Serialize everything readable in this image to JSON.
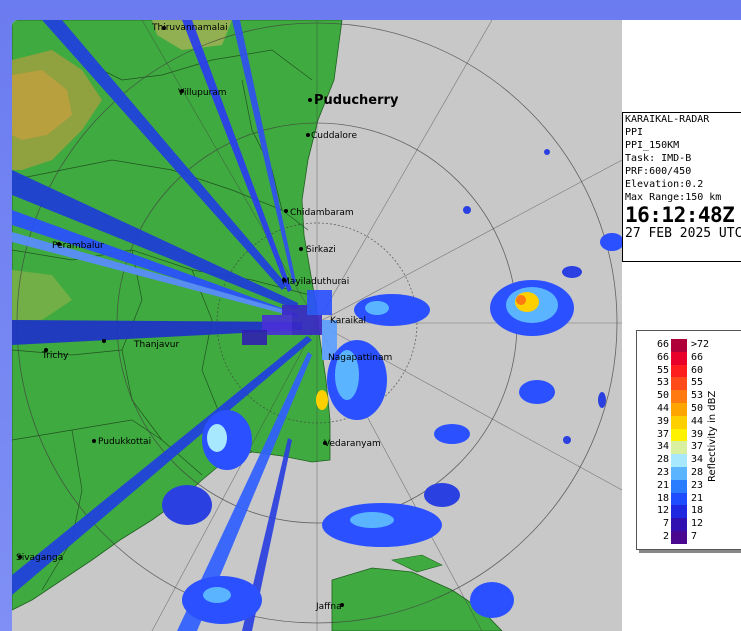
{
  "info": {
    "station": "KARAIKAL-RADAR",
    "product": "PPI",
    "range_product": "PPI_150KM",
    "task": "Task: IMD-B",
    "prf": "PRF:600/450",
    "elevation": "Elevation:0.2",
    "max_range": "Max Range:150 km",
    "time": "16:12:48Z",
    "date": "27 FEB 2025 UTC"
  },
  "legend": {
    "title": "Reflectivity in dBZ",
    "rows": [
      {
        "left": "66",
        "right": ">72",
        "color": "#b0003a"
      },
      {
        "left": "66",
        "right": "66",
        "color": "#e8002a"
      },
      {
        "left": "55",
        "right": "60",
        "color": "#ff1e1e"
      },
      {
        "left": "53",
        "right": "55",
        "color": "#ff4a1a"
      },
      {
        "left": "50",
        "right": "53",
        "color": "#ff7a10"
      },
      {
        "left": "44",
        "right": "50",
        "color": "#ffa500"
      },
      {
        "left": "39",
        "right": "44",
        "color": "#ffd000"
      },
      {
        "left": "37",
        "right": "39",
        "color": "#fff200"
      },
      {
        "left": "34",
        "right": "37",
        "color": "#d8f0a0"
      },
      {
        "left": "28",
        "right": "34",
        "color": "#a8e8ff"
      },
      {
        "left": "23",
        "right": "28",
        "color": "#5ab4ff"
      },
      {
        "left": "21",
        "right": "23",
        "color": "#2a7dff"
      },
      {
        "left": "18",
        "right": "21",
        "color": "#1e4dff"
      },
      {
        "left": "12",
        "right": "18",
        "color": "#1e28e0"
      },
      {
        "left": "7",
        "right": "12",
        "color": "#3010b0"
      },
      {
        "left": "2",
        "right": "7",
        "color": "#4a0890"
      }
    ]
  },
  "places": {
    "thiruvannamalai": "Thiruvannamalai",
    "villupuram": "Villupuram",
    "puducherry": "Puducherry",
    "cuddalore": "Cuddalore",
    "chidambaram": "Chidambaram",
    "sirkazhi": "Sirkazi",
    "mayiladuthurai": "Mayiladuthurai",
    "perambalur": "Perambalur",
    "karaikal": "Karaikal",
    "nagapattinam": "Nagapattinam",
    "trichy": "Trichy",
    "thanjavur": "Thanjavur",
    "pudukkottai": "Pudukkottai",
    "vedaranyam": "Vedaranyam",
    "sivaganga": "Sivaganga",
    "jaffna": "Jaffna"
  },
  "colors": {
    "land": "#3faa3f",
    "sea": "#c8c8c8",
    "frame_bg": "#7080f2"
  }
}
